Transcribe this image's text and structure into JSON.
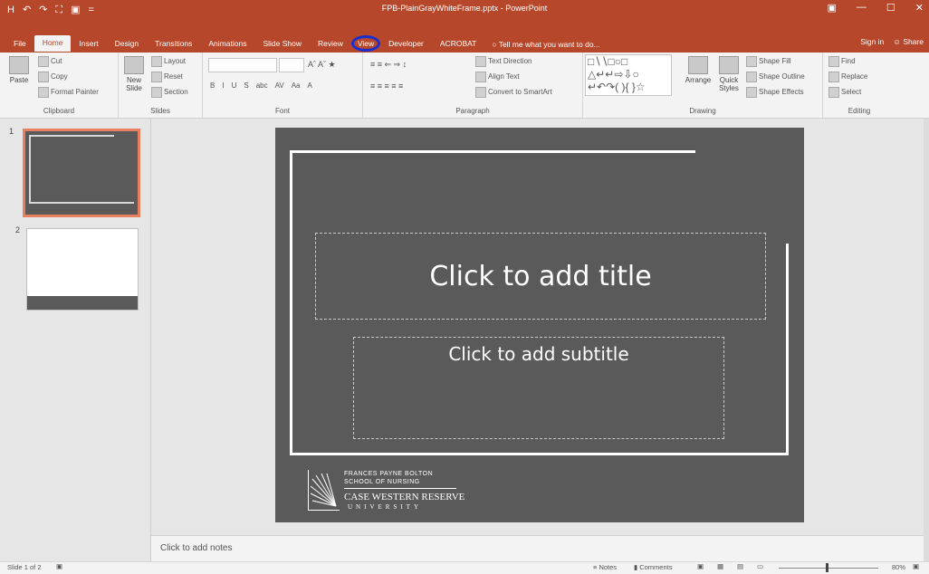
{
  "window": {
    "title": "FPB-PlainGrayWhiteFrame.pptx - PowerPoint",
    "controls": [
      "▣",
      "—",
      "☐",
      "✕"
    ]
  },
  "qat": [
    "H",
    "↶",
    "↷",
    "⛶",
    "▣",
    "="
  ],
  "tabs": [
    "File",
    "Home",
    "Insert",
    "Design",
    "Transitions",
    "Animations",
    "Slide Show",
    "Review",
    "View",
    "Developer",
    "ACROBAT"
  ],
  "tell_me": "Tell me what you want to do...",
  "account": {
    "sign_in": "Sign in",
    "share": "Share"
  },
  "ribbon": {
    "clipboard": {
      "paste": "Paste",
      "cut": "Cut",
      "copy": "Copy",
      "format_painter": "Format Painter",
      "label": "Clipboard"
    },
    "slides": {
      "new_slide": "New Slide",
      "layout": "Layout",
      "reset": "Reset",
      "section": "Section",
      "label": "Slides"
    },
    "font": {
      "label": "Font",
      "buttons": [
        "B",
        "I",
        "U",
        "S",
        "abc",
        "AV",
        "Aa",
        "A"
      ]
    },
    "paragraph": {
      "text_direction": "Text Direction",
      "align_text": "Align Text",
      "convert": "Convert to SmartArt",
      "label": "Paragraph"
    },
    "drawing": {
      "arrange": "Arrange",
      "quick_styles": "Quick Styles",
      "shape_fill": "Shape Fill",
      "shape_outline": "Shape Outline",
      "shape_effects": "Shape Effects",
      "label": "Drawing"
    },
    "editing": {
      "find": "Find",
      "replace": "Replace",
      "select": "Select",
      "label": "Editing"
    }
  },
  "thumbnails": [
    "1",
    "2"
  ],
  "slide": {
    "title_placeholder": "Click to add title",
    "subtitle_placeholder": "Click to add subtitle",
    "logo": {
      "line1": "FRANCES PAYNE BOLTON",
      "line2": "SCHOOL OF NURSING",
      "line3": "CASE WESTERN RESERVE",
      "line4": "UNIVERSITY"
    }
  },
  "notes_placeholder": "Click to add notes",
  "status": {
    "slide_count": "Slide 1 of 2",
    "notes": "Notes",
    "comments": "Comments",
    "zoom": "80%"
  },
  "colors": {
    "accent": "#b7472a",
    "slide_bg": "#5a5a5a",
    "annotation_circle": "#1a2fd0"
  }
}
